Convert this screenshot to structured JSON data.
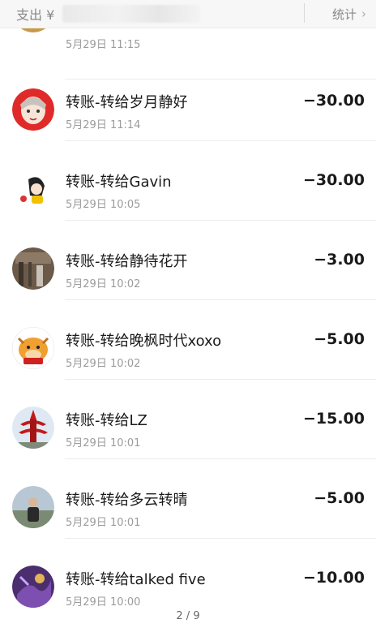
{
  "header": {
    "label": "支出 ¥",
    "stats_label": "统计",
    "chevron": "›"
  },
  "partial_row": {
    "time": "5月29日 11:15"
  },
  "transactions": [
    {
      "title": "转账-转给岁月静好",
      "time": "5月29日 11:14",
      "amount": "−30.00",
      "avatar_icon": "avatar-anime-boy-icon"
    },
    {
      "title": "转账-转给Gavin",
      "time": "5月29日 10:05",
      "amount": "−30.00",
      "avatar_icon": "avatar-cartoon-girl-icon"
    },
    {
      "title": "转账-转给静待花开",
      "time": "5月29日 10:02",
      "amount": "−3.00",
      "avatar_icon": "avatar-photo-icon"
    },
    {
      "title": "转账-转给晚枫时代xoxo",
      "time": "5月29日 10:02",
      "amount": "−5.00",
      "avatar_icon": "avatar-cartoon-cow-icon"
    },
    {
      "title": "转账-转给LZ",
      "time": "5月29日 10:01",
      "amount": "−15.00",
      "avatar_icon": "avatar-red-tower-icon"
    },
    {
      "title": "转账-转给多云转晴",
      "time": "5月29日 10:01",
      "amount": "−5.00",
      "avatar_icon": "avatar-person-photo-icon"
    },
    {
      "title": "转账-转给talked five",
      "time": "5月29日 10:00",
      "amount": "−10.00",
      "avatar_icon": "avatar-purple-art-icon"
    }
  ],
  "pagination": {
    "text": "2 / 9"
  }
}
